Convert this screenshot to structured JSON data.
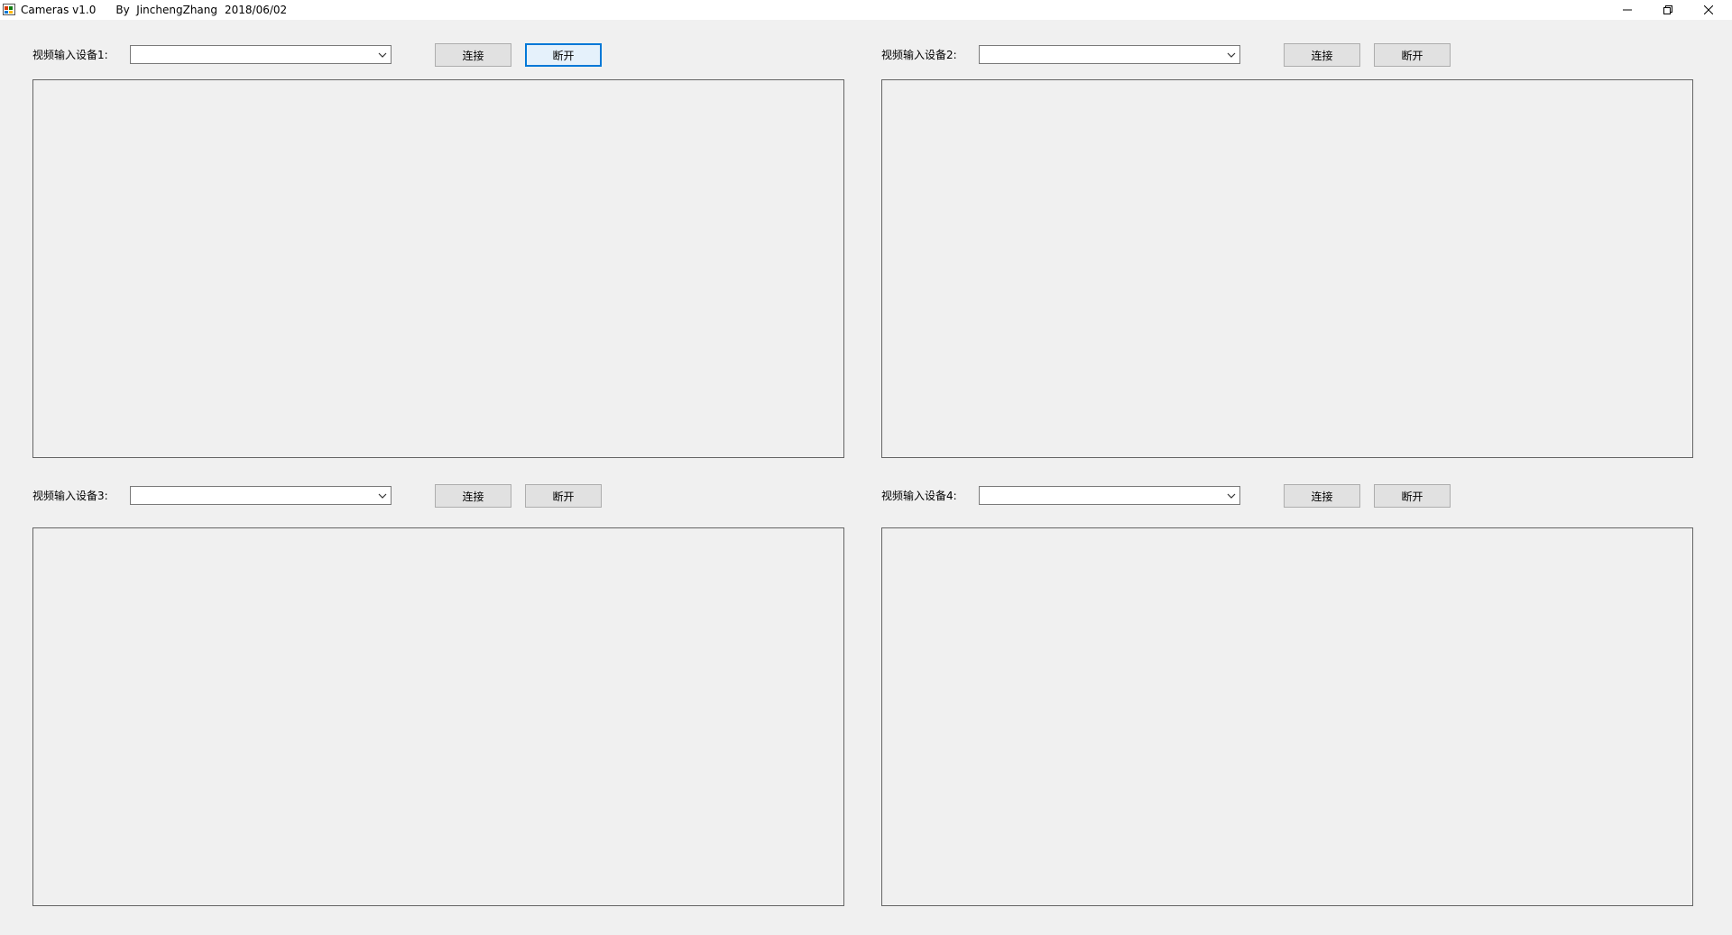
{
  "window": {
    "app_title": "Cameras v1.0",
    "author": "By  JinchengZhang",
    "date": "2018/06/02"
  },
  "devices": [
    {
      "label": "视频输入设备1:",
      "selected": "",
      "connect": "连接",
      "disconnect": "断开"
    },
    {
      "label": "视频输入设备2:",
      "selected": "",
      "connect": "连接",
      "disconnect": "断开"
    },
    {
      "label": "视频输入设备3:",
      "selected": "",
      "connect": "连接",
      "disconnect": "断开"
    },
    {
      "label": "视频输入设备4:",
      "selected": "",
      "connect": "连接",
      "disconnect": "断开"
    }
  ],
  "icons": {
    "app": "app-icon",
    "minimize": "minimize-icon",
    "restore": "restore-icon",
    "close": "close-icon",
    "dropdown": "chevron-down-icon"
  },
  "colors": {
    "focus_accent": "#0078d7",
    "window_bg": "#f0f0f0"
  }
}
